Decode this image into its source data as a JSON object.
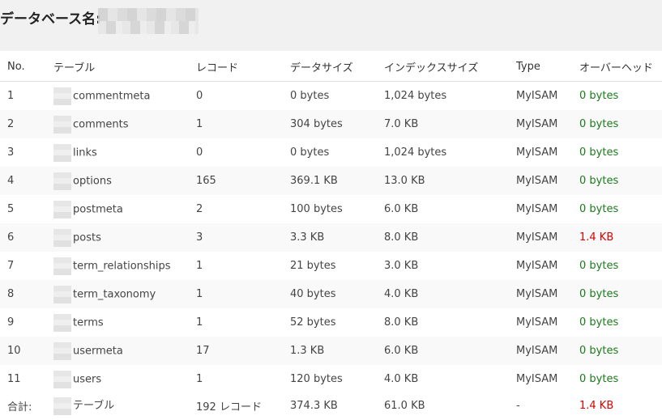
{
  "header": {
    "title": "データベース名:"
  },
  "table": {
    "columns": [
      "No.",
      "テーブル",
      "レコード",
      "データサイズ",
      "インデックスサイズ",
      "Type",
      "オーバーヘッド"
    ],
    "rows": [
      {
        "no": "1",
        "name": "commentmeta",
        "records": "0",
        "data": "0 bytes",
        "index": "1,024 bytes",
        "type": "MyISAM",
        "overhead": "0 bytes",
        "status": "ok"
      },
      {
        "no": "2",
        "name": "comments",
        "records": "1",
        "data": "304 bytes",
        "index": "7.0 KB",
        "type": "MyISAM",
        "overhead": "0 bytes",
        "status": "ok"
      },
      {
        "no": "3",
        "name": "links",
        "records": "0",
        "data": "0 bytes",
        "index": "1,024 bytes",
        "type": "MyISAM",
        "overhead": "0 bytes",
        "status": "ok"
      },
      {
        "no": "4",
        "name": "options",
        "records": "165",
        "data": "369.1 KB",
        "index": "13.0 KB",
        "type": "MyISAM",
        "overhead": "0 bytes",
        "status": "ok"
      },
      {
        "no": "5",
        "name": "postmeta",
        "records": "2",
        "data": "100 bytes",
        "index": "6.0 KB",
        "type": "MyISAM",
        "overhead": "0 bytes",
        "status": "ok"
      },
      {
        "no": "6",
        "name": "posts",
        "records": "3",
        "data": "3.3 KB",
        "index": "8.0 KB",
        "type": "MyISAM",
        "overhead": "1.4 KB",
        "status": "bad"
      },
      {
        "no": "7",
        "name": "term_relationships",
        "records": "1",
        "data": "21 bytes",
        "index": "3.0 KB",
        "type": "MyISAM",
        "overhead": "0 bytes",
        "status": "ok"
      },
      {
        "no": "8",
        "name": "term_taxonomy",
        "records": "1",
        "data": "40 bytes",
        "index": "4.0 KB",
        "type": "MyISAM",
        "overhead": "0 bytes",
        "status": "ok"
      },
      {
        "no": "9",
        "name": "terms",
        "records": "1",
        "data": "52 bytes",
        "index": "8.0 KB",
        "type": "MyISAM",
        "overhead": "0 bytes",
        "status": "ok"
      },
      {
        "no": "10",
        "name": "usermeta",
        "records": "17",
        "data": "1.3 KB",
        "index": "6.0 KB",
        "type": "MyISAM",
        "overhead": "0 bytes",
        "status": "ok"
      },
      {
        "no": "11",
        "name": "users",
        "records": "1",
        "data": "120 bytes",
        "index": "4.0 KB",
        "type": "MyISAM",
        "overhead": "0 bytes",
        "status": "ok"
      }
    ],
    "total": {
      "label": "合計:",
      "tables": "テーブル",
      "records": "192 レコード",
      "data": "374.3 KB",
      "index": "61.0 KB",
      "type": "-",
      "overhead": "1.4 KB"
    }
  },
  "colors": {
    "ok": "#1c7a1c",
    "bad": "#dd0000",
    "header_band": "#f1f1f1",
    "row_stripe": "#f9f9f9"
  }
}
